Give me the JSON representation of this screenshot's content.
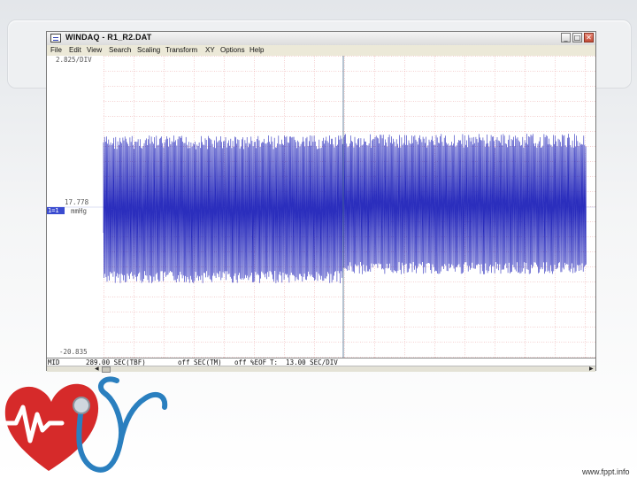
{
  "window": {
    "title": "WINDAQ - R1_R2.DAT",
    "controls": {
      "minimize": "_",
      "maximize": "□",
      "close": "✕"
    }
  },
  "menu": [
    "File",
    "Edit",
    "View",
    "Search",
    "Scaling",
    "Transform",
    "XY",
    "Options",
    "Help"
  ],
  "plot": {
    "top_label": "2.825/DIV",
    "mid_value": "17.778",
    "mid_unit": "mmHg",
    "bottom_label": "-20.835",
    "channel_badge": "1=1",
    "colors": {
      "trace": "#2b2ebd",
      "grid": "#e9a0a0",
      "cursor": "#4a6a8a"
    }
  },
  "status": {
    "mode": "MID",
    "time": "289.00 SEC(TBF)",
    "tm": "off SEC(TM)",
    "eof": "off %EOF",
    "timescale": "T:  13.00 SEC/DIV"
  },
  "footer": {
    "credit": "www.fppt.info"
  },
  "logo": {
    "icon": "heart-stethoscope-icon",
    "colors": {
      "heart": "#d62a2a",
      "stethoscope": "#2a7fbf"
    }
  }
}
